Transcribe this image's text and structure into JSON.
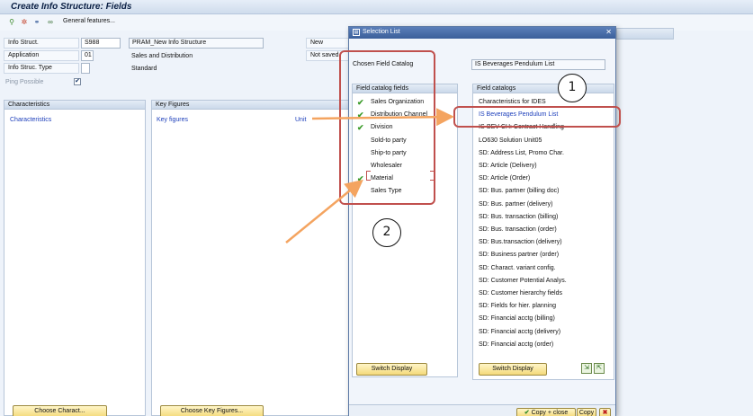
{
  "window": {
    "title": "Create Info Structure: Fields"
  },
  "toolbar": {
    "general_features": "General features..."
  },
  "header": {
    "info_struct_label": "Info Struct.",
    "info_struct_value": "S988",
    "info_struct_desc": "PRAM_New Info Structure",
    "status_new": "New",
    "application_label": "Application",
    "application_value": "01",
    "application_desc": "Sales and Distribution",
    "status_saved": "Not saved",
    "type_label": "Info Struc. Type",
    "type_value": "Standard",
    "ping_label": "Ping Possible",
    "ping_checked": "✔"
  },
  "characteristics": {
    "header": "Characteristics",
    "item": "Characteristics",
    "button": "Choose Charact..."
  },
  "key_figures": {
    "header": "Key Figures",
    "item": "Key figures",
    "unit": "Unit",
    "button": "Choose Key Figures..."
  },
  "dialog": {
    "title": "Selection List",
    "chosen_label": "Chosen Field Catalog",
    "chosen_value": "IS Beverages Pendulum List",
    "fields_header": "Field catalog fields",
    "fields": [
      {
        "label": "Sales Organization",
        "checked": true
      },
      {
        "label": "Distribution Channel",
        "checked": true
      },
      {
        "label": "Division",
        "checked": true
      },
      {
        "label": "Sold-to party",
        "checked": false
      },
      {
        "label": "Ship-to party",
        "checked": false
      },
      {
        "label": "Wholesaler",
        "checked": false
      },
      {
        "label": "Material",
        "checked": true
      },
      {
        "label": "Sales Type",
        "checked": false
      }
    ],
    "catalogs_header": "Field catalogs",
    "catalogs": [
      "Characteristics for IDES",
      "IS Beverages Pendulum List",
      "IS-BEV-CH: Contract Handling",
      "LO630 Solution Unit05",
      "SD: Address List, Promo Char.",
      "SD: Article (Delivery)",
      "SD: Article (Order)",
      "SD: Bus. partner (billing doc)",
      "SD: Bus. partner (delivery)",
      "SD: Bus. transaction (billing)",
      "SD: Bus. transaction (order)",
      "SD: Bus.transaction (delivery)",
      "SD: Business partner (order)",
      "SD: Charact. variant config.",
      "SD: Customer Potential Analys.",
      "SD: Customer hierarchy fields",
      "SD: Fields for hier. planning",
      "SD: Financial acctg (billing)",
      "SD: Financial acctg (delivery)",
      "SD: Financial acctg (order)"
    ],
    "switch_display_left": "Switch Display",
    "switch_display_right": "Switch Display",
    "copy_close": "Copy + close",
    "copy": "Copy"
  },
  "annotations": {
    "marker_1": "1",
    "marker_2": "2"
  },
  "colors": {
    "annotation_red": "#c0504d",
    "arrow_orange": "#f4a460",
    "check_green": "#3b9b2a"
  }
}
